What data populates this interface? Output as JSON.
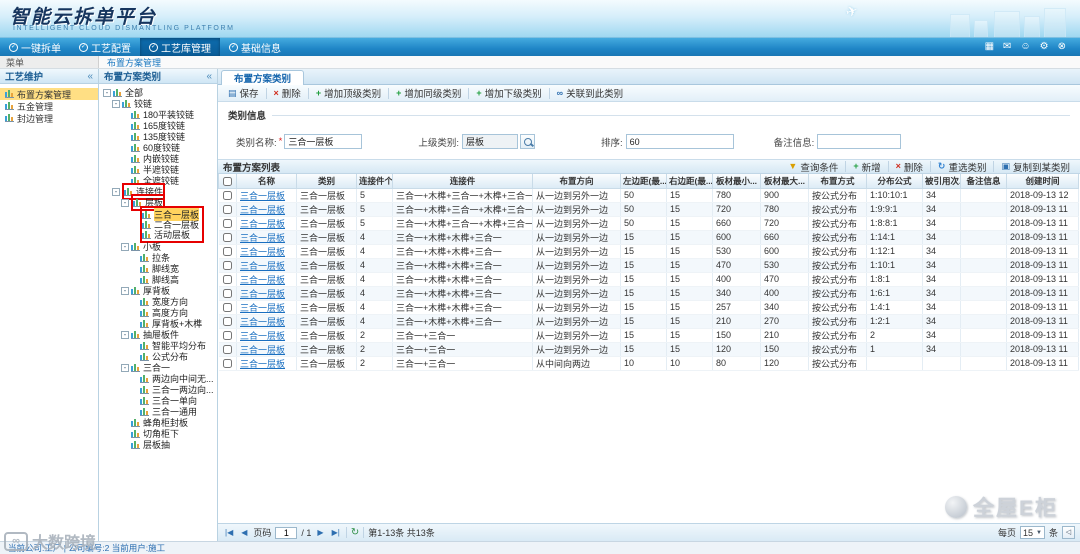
{
  "header": {
    "title": "智能云拆单平台",
    "subtitle": "INTELLIGENT CLOUD DISMANTLING PLATFORM"
  },
  "nav": {
    "tabs": [
      {
        "label": "一键拆单",
        "active": false
      },
      {
        "label": "工艺配置",
        "active": false
      },
      {
        "label": "工艺库管理",
        "active": true
      },
      {
        "label": "基础信息",
        "active": false
      }
    ],
    "icons": [
      "grid-icon",
      "message-icon",
      "user-icon",
      "gear-icon",
      "exit-icon"
    ]
  },
  "breadcrumb": {
    "menu_label": "菜单",
    "path": "布置方案管理"
  },
  "sidebar": {
    "title": "工艺维护",
    "collapse_glyph": "«",
    "items": [
      {
        "label": "布置方案管理",
        "selected": true
      },
      {
        "label": "五金管理",
        "selected": false
      },
      {
        "label": "封边管理",
        "selected": false
      }
    ]
  },
  "tree_panel": {
    "title": "布置方案类别",
    "collapse_glyph": "«",
    "nodes": [
      {
        "label": "全部",
        "level": 0,
        "exp": "open"
      },
      {
        "label": "铰链",
        "level": 1,
        "exp": "open"
      },
      {
        "label": "180平装铰链",
        "level": 2
      },
      {
        "label": "165度铰链",
        "level": 2
      },
      {
        "label": "135度铰链",
        "level": 2
      },
      {
        "label": "60度铰链",
        "level": 2
      },
      {
        "label": "内嵌铰链",
        "level": 2
      },
      {
        "label": "半遮铰链",
        "level": 2
      },
      {
        "label": "全遮铰链",
        "level": 2
      },
      {
        "label": "连接件",
        "level": 1,
        "exp": "open",
        "red": "single"
      },
      {
        "label": "层板",
        "level": 2,
        "exp": "open",
        "red": "single"
      },
      {
        "label": "三合一层板",
        "level": 3,
        "selected": true,
        "red": "top"
      },
      {
        "label": "二合一层板",
        "level": 3,
        "red": "mid"
      },
      {
        "label": "活动层板",
        "level": 3,
        "red": "bottom"
      },
      {
        "label": "小板",
        "level": 2,
        "exp": "open"
      },
      {
        "label": "拉条",
        "level": 3
      },
      {
        "label": "脚线宽",
        "level": 3
      },
      {
        "label": "脚线高",
        "level": 3
      },
      {
        "label": "厚背板",
        "level": 2,
        "exp": "open"
      },
      {
        "label": "宽度方向",
        "level": 3
      },
      {
        "label": "高度方向",
        "level": 3
      },
      {
        "label": "厚背板+木榫",
        "level": 3
      },
      {
        "label": "抽屉板件",
        "level": 2,
        "exp": "open"
      },
      {
        "label": "智能平均分布",
        "level": 3
      },
      {
        "label": "公式分布",
        "level": 3
      },
      {
        "label": "三合一",
        "level": 2,
        "exp": "open"
      },
      {
        "label": "两边向中间无...",
        "level": 3
      },
      {
        "label": "三合一两边向...",
        "level": 3
      },
      {
        "label": "三合一单向",
        "level": 3
      },
      {
        "label": "三合一通用",
        "level": 3
      },
      {
        "label": "蜂角柜封板",
        "level": 2
      },
      {
        "label": "切角柜下",
        "level": 2
      },
      {
        "label": "层板抽",
        "level": 2
      }
    ]
  },
  "main": {
    "tab": "布置方案类别",
    "toolbar": [
      {
        "label": "保存",
        "icon": "save"
      },
      {
        "label": "删除",
        "icon": "delete"
      },
      {
        "label": "增加顶级类别",
        "icon": "add"
      },
      {
        "label": "增加同级类别",
        "icon": "add"
      },
      {
        "label": "增加下级类别",
        "icon": "add"
      },
      {
        "label": "关联到此类别",
        "icon": "link"
      }
    ],
    "form": {
      "title": "类别信息",
      "name_label": "类别名称:",
      "name_required": "*",
      "name_value": "三合一层板",
      "parent_label": "上级类别:",
      "parent_value": "层板",
      "sort_label": "排序:",
      "sort_value": "60",
      "note_label": "备注信息:",
      "note_value": ""
    },
    "list": {
      "title": "布置方案列表",
      "toolbar": [
        {
          "label": "查询条件",
          "icon": "filter"
        },
        {
          "label": "新增",
          "icon": "add"
        },
        {
          "label": "删除",
          "icon": "delete"
        },
        {
          "label": "重选类别",
          "icon": "reselect"
        },
        {
          "label": "复制到某类别",
          "icon": "copy"
        }
      ],
      "columns": [
        "名称",
        "类别",
        "连接件个...",
        "连接件",
        "布置方向",
        "左边距(最...",
        "右边距(最...",
        "板材最小...",
        "板材最大...",
        "布置方式",
        "分布公式",
        "被引用次...",
        "备注信息",
        "创建时间"
      ],
      "rows": [
        [
          "三合一层板",
          "三合一层板",
          "5",
          "三合一+木榫+三合一+木榫+三合一",
          "从一边到另外一边",
          "50",
          "15",
          "780",
          "900",
          "按公式分布",
          "1:10:10:1",
          "34",
          "",
          "2018-09-13 12"
        ],
        [
          "三合一层板",
          "三合一层板",
          "5",
          "三合一+木榫+三合一+木榫+三合一",
          "从一边到另外一边",
          "50",
          "15",
          "720",
          "780",
          "按公式分布",
          "1:9:9:1",
          "34",
          "",
          "2018-09-13 11"
        ],
        [
          "三合一层板",
          "三合一层板",
          "5",
          "三合一+木榫+三合一+木榫+三合一",
          "从一边到另外一边",
          "50",
          "15",
          "660",
          "720",
          "按公式分布",
          "1:8:8:1",
          "34",
          "",
          "2018-09-13 11"
        ],
        [
          "三合一层板",
          "三合一层板",
          "4",
          "三合一+木榫+木榫+三合一",
          "从一边到另外一边",
          "15",
          "15",
          "600",
          "660",
          "按公式分布",
          "1:14:1",
          "34",
          "",
          "2018-09-13 11"
        ],
        [
          "三合一层板",
          "三合一层板",
          "4",
          "三合一+木榫+木榫+三合一",
          "从一边到另外一边",
          "15",
          "15",
          "530",
          "600",
          "按公式分布",
          "1:12:1",
          "34",
          "",
          "2018-09-13 11"
        ],
        [
          "三合一层板",
          "三合一层板",
          "4",
          "三合一+木榫+木榫+三合一",
          "从一边到另外一边",
          "15",
          "15",
          "470",
          "530",
          "按公式分布",
          "1:10:1",
          "34",
          "",
          "2018-09-13 11"
        ],
        [
          "三合一层板",
          "三合一层板",
          "4",
          "三合一+木榫+木榫+三合一",
          "从一边到另外一边",
          "15",
          "15",
          "400",
          "470",
          "按公式分布",
          "1:8:1",
          "34",
          "",
          "2018-09-13 11"
        ],
        [
          "三合一层板",
          "三合一层板",
          "4",
          "三合一+木榫+木榫+三合一",
          "从一边到另外一边",
          "15",
          "15",
          "340",
          "400",
          "按公式分布",
          "1:6:1",
          "34",
          "",
          "2018-09-13 11"
        ],
        [
          "三合一层板",
          "三合一层板",
          "4",
          "三合一+木榫+木榫+三合一",
          "从一边到另外一边",
          "15",
          "15",
          "257",
          "340",
          "按公式分布",
          "1:4:1",
          "34",
          "",
          "2018-09-13 11"
        ],
        [
          "三合一层板",
          "三合一层板",
          "4",
          "三合一+木榫+木榫+三合一",
          "从一边到另外一边",
          "15",
          "15",
          "210",
          "270",
          "按公式分布",
          "1:2:1",
          "34",
          "",
          "2018-09-13 11"
        ],
        [
          "三合一层板",
          "三合一层板",
          "2",
          "三合一+三合一",
          "从一边到另外一边",
          "15",
          "15",
          "150",
          "210",
          "按公式分布",
          "2",
          "34",
          "",
          "2018-09-13 11"
        ],
        [
          "三合一层板",
          "三合一层板",
          "2",
          "三合一+三合一",
          "从一边到另外一边",
          "15",
          "15",
          "120",
          "150",
          "按公式分布",
          "1",
          "34",
          "",
          "2018-09-13 11"
        ],
        [
          "三合一层板",
          "三合一层板",
          "2",
          "三合一+三合一",
          "从中间向两边",
          "10",
          "10",
          "80",
          "120",
          "按公式分布",
          "",
          "",
          "",
          "2018-09-13 11"
        ]
      ]
    },
    "pagination": {
      "icons": {
        "first": "|◀",
        "prev": "◀",
        "next": "▶",
        "last": "▶|",
        "refresh": "↻"
      },
      "page_label": "页码",
      "page_value": "1",
      "page_total": "/ 1",
      "info": "第1-13条 共13条",
      "per_page_label": "每页",
      "per_page_value": "15",
      "per_page_suffix": "条"
    }
  },
  "status_bar": {
    "text": "当前公司:工厂 | 公司编号:2    当前用户:施工"
  },
  "watermarks": {
    "bottom_left_logo": "∞",
    "bottom_left": "大数跨境",
    "bottom_right": "全屋E柜"
  },
  "colors": {
    "accent": "#1f85c6",
    "selection": "#ffd978",
    "link": "#1a6fc0",
    "annotation": "#e60000"
  }
}
